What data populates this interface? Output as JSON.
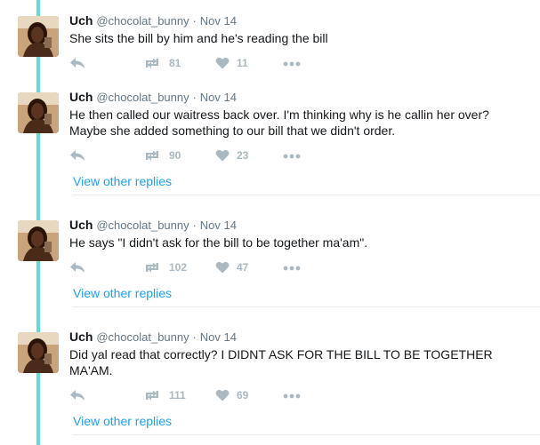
{
  "tweets": [
    {
      "name": "Uch",
      "handle": "@chocolat_bunny",
      "time": "Nov 14",
      "text": "She sits the bill by him and he's reading the bill",
      "retweets": "81",
      "likes": "11",
      "view_replies": ""
    },
    {
      "name": "Uch",
      "handle": "@chocolat_bunny",
      "time": "Nov 14",
      "text": "He then called our waitress back over. I'm thinking why is he callin her over? Maybe she added something to our bill that we didn't order.",
      "retweets": "90",
      "likes": "23",
      "view_replies": "View other replies"
    },
    {
      "name": "Uch",
      "handle": "@chocolat_bunny",
      "time": "Nov 14",
      "text": "He says \"I didn't ask for the bill to be together ma'am\".",
      "retweets": "102",
      "likes": "47",
      "view_replies": "View other replies"
    },
    {
      "name": "Uch",
      "handle": "@chocolat_bunny",
      "time": "Nov 14",
      "text": "Did yal read that correctly? I DIDNT ASK FOR THE BILL TO BE TOGETHER MA'AM.",
      "retweets": "111",
      "likes": "69",
      "view_replies": "View other replies"
    }
  ],
  "header_separator": "·",
  "colors": {
    "thread_line": "#63dcd8",
    "link": "#1da1f2",
    "secondary_text": "#657786",
    "action_icon": "#aab8c2"
  },
  "icons": [
    "reply-icon",
    "retweet-icon",
    "like-icon",
    "more-icon"
  ]
}
